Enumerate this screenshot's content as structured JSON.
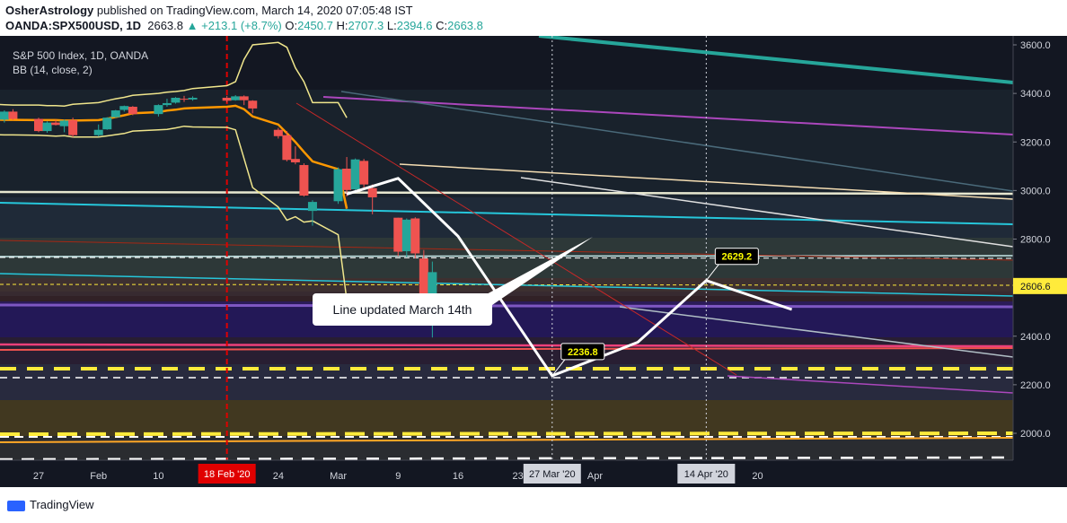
{
  "header": {
    "publisher": "OsherAstrology",
    "published_text": "published on TradingView.com, March 14, 2020 07:05:48 IST",
    "symbol": "OANDA:SPX500USD, 1D",
    "price": "2663.8",
    "change": "▲ +213.1 (+8.7%)",
    "o_label": "O:",
    "o_val": "2450.7",
    "h_label": "H:",
    "h_val": "2707.3",
    "l_label": "L:",
    "l_val": "2394.6",
    "c_label": "C:",
    "c_val": "2663.8"
  },
  "legend": {
    "title": "S&P 500 Index, 1D, OANDA",
    "indicator": "BB (14, close, 2)"
  },
  "callout": "Line updated March 14th",
  "footer": {
    "logo_text": "TradingView"
  },
  "colors": {
    "background": "#131722",
    "up_candle": "#26a69a",
    "down_candle": "#ef5350",
    "bb_band": "#f0e68c",
    "bb_basis": "#ff9800",
    "projection": "#ffffff",
    "marker_label_bg": "#000000",
    "marker_label_text": "#ffff00"
  },
  "chart_data": {
    "type": "candlestick",
    "symbol": "OANDA:SPX500USD",
    "interval": "1D",
    "y_range": [
      1900,
      3650
    ],
    "y_ticks": [
      2000,
      2200,
      2400,
      2600,
      2800,
      3000,
      3200,
      3400,
      3600
    ],
    "y_tick_labels": [
      "2000.0",
      "2200.0",
      "2400.0",
      "2600.0",
      "2800.0",
      "3000.0",
      "3200.0",
      "3400.0",
      "3600.0"
    ],
    "x_ticks": [
      {
        "label": "27",
        "date": "2020-01-27"
      },
      {
        "label": "Feb",
        "date": "2020-02-03"
      },
      {
        "label": "10",
        "date": "2020-02-10"
      },
      {
        "label": "24",
        "date": "2020-02-24"
      },
      {
        "label": "Mar",
        "date": "2020-03-02"
      },
      {
        "label": "9",
        "date": "2020-03-09"
      },
      {
        "label": "16",
        "date": "2020-03-16"
      },
      {
        "label": "23",
        "date": "2020-03-23"
      },
      {
        "label": "Apr",
        "date": "2020-04-01"
      },
      {
        "label": "20",
        "date": "2020-04-20"
      }
    ],
    "candles": [
      {
        "date": "2020-01-21",
        "o": 3320,
        "h": 3330,
        "l": 3300,
        "c": 3322
      },
      {
        "date": "2020-01-22",
        "o": 3322,
        "h": 3332,
        "l": 3290,
        "c": 3292
      },
      {
        "date": "2020-01-23",
        "o": 3292,
        "h": 3330,
        "l": 3280,
        "c": 3325
      },
      {
        "date": "2020-01-24",
        "o": 3325,
        "h": 3335,
        "l": 3290,
        "c": 3295
      },
      {
        "date": "2020-01-27",
        "o": 3295,
        "h": 3300,
        "l": 3240,
        "c": 3245
      },
      {
        "date": "2020-01-28",
        "o": 3245,
        "h": 3285,
        "l": 3238,
        "c": 3280
      },
      {
        "date": "2020-01-29",
        "o": 3280,
        "h": 3292,
        "l": 3268,
        "c": 3270
      },
      {
        "date": "2020-01-30",
        "o": 3265,
        "h": 3292,
        "l": 3240,
        "c": 3288
      },
      {
        "date": "2020-01-31",
        "o": 3290,
        "h": 3300,
        "l": 3220,
        "c": 3228
      },
      {
        "date": "2020-02-03",
        "o": 3228,
        "h": 3272,
        "l": 3222,
        "c": 3250
      },
      {
        "date": "2020-02-04",
        "o": 3252,
        "h": 3302,
        "l": 3250,
        "c": 3300
      },
      {
        "date": "2020-02-05",
        "o": 3302,
        "h": 3332,
        "l": 3300,
        "c": 3330
      },
      {
        "date": "2020-02-06",
        "o": 3332,
        "h": 3350,
        "l": 3325,
        "c": 3348
      },
      {
        "date": "2020-02-07",
        "o": 3345,
        "h": 3348,
        "l": 3310,
        "c": 3315
      },
      {
        "date": "2020-02-10",
        "o": 3315,
        "h": 3355,
        "l": 3305,
        "c": 3352
      },
      {
        "date": "2020-02-11",
        "o": 3352,
        "h": 3378,
        "l": 3345,
        "c": 3360
      },
      {
        "date": "2020-02-12",
        "o": 3362,
        "h": 3385,
        "l": 3358,
        "c": 3382
      },
      {
        "date": "2020-02-13",
        "o": 3378,
        "h": 3390,
        "l": 3365,
        "c": 3375
      },
      {
        "date": "2020-02-14",
        "o": 3375,
        "h": 3388,
        "l": 3370,
        "c": 3382
      },
      {
        "date": "2020-02-18",
        "o": 3382,
        "h": 3390,
        "l": 3362,
        "c": 3370
      },
      {
        "date": "2020-02-19",
        "o": 3372,
        "h": 3393,
        "l": 3370,
        "c": 3388
      },
      {
        "date": "2020-02-20",
        "o": 3388,
        "h": 3392,
        "l": 3352,
        "c": 3372
      },
      {
        "date": "2020-02-21",
        "o": 3370,
        "h": 3372,
        "l": 3318,
        "c": 3338
      },
      {
        "date": "2020-02-24",
        "o": 3250,
        "h": 3258,
        "l": 3214,
        "c": 3224
      },
      {
        "date": "2020-02-25",
        "o": 3228,
        "h": 3245,
        "l": 3120,
        "c": 3126
      },
      {
        "date": "2020-02-26",
        "o": 3130,
        "h": 3182,
        "l": 3108,
        "c": 3116
      },
      {
        "date": "2020-02-27",
        "o": 3105,
        "h": 3112,
        "l": 2975,
        "c": 2979
      },
      {
        "date": "2020-02-28",
        "o": 2916,
        "h": 2960,
        "l": 2855,
        "c": 2953
      },
      {
        "date": "2020-03-02",
        "o": 2956,
        "h": 3095,
        "l": 2945,
        "c": 3088
      },
      {
        "date": "2020-03-03",
        "o": 3090,
        "h": 3138,
        "l": 2975,
        "c": 3002
      },
      {
        "date": "2020-03-04",
        "o": 3005,
        "h": 3132,
        "l": 3002,
        "c": 3128
      },
      {
        "date": "2020-03-05",
        "o": 3122,
        "h": 3130,
        "l": 3005,
        "c": 3025
      },
      {
        "date": "2020-03-06",
        "o": 3010,
        "h": 3025,
        "l": 2902,
        "c": 2972
      },
      {
        "date": "2020-03-09",
        "o": 2888,
        "h": 2888,
        "l": 2730,
        "c": 2748
      },
      {
        "date": "2020-03-10",
        "o": 2750,
        "h": 2885,
        "l": 2725,
        "c": 2880
      },
      {
        "date": "2020-03-11",
        "o": 2885,
        "h": 2890,
        "l": 2720,
        "c": 2741
      },
      {
        "date": "2020-03-12",
        "o": 2720,
        "h": 2755,
        "l": 2450,
        "c": 2450
      },
      {
        "date": "2020-03-13",
        "o": 2450.7,
        "h": 2707.3,
        "l": 2394.6,
        "c": 2663.8
      }
    ],
    "bollinger": {
      "period": 14,
      "source": "close",
      "mult": 2,
      "upper": [
        3353,
        3355,
        3353,
        3352,
        3352,
        3350,
        3350,
        3348,
        3355,
        3362,
        3370,
        3378,
        3384,
        3392,
        3400,
        3405,
        3408,
        3412,
        3420,
        3432,
        3448,
        3540,
        3600,
        3610,
        3590,
        3505,
        3448,
        3362,
        3362,
        3300
      ],
      "basis": [
        3292,
        3292,
        3291,
        3291,
        3290,
        3290,
        3290,
        3288,
        3288,
        3290,
        3296,
        3303,
        3310,
        3318,
        3323,
        3329,
        3333,
        3338,
        3340,
        3345,
        3349,
        3335,
        3305,
        3272,
        3236,
        3200,
        3159,
        3120,
        3088,
        2925
      ],
      "lower": [
        3232,
        3230,
        3229,
        3229,
        3228,
        3226,
        3224,
        3226,
        3220,
        3220,
        3225,
        3230,
        3235,
        3245,
        3250,
        3252,
        3258,
        3265,
        3262,
        3260,
        3250,
        3132,
        3012,
        2932,
        2878,
        2892,
        2870,
        2875,
        2818,
        2550
      ]
    },
    "projection": [
      {
        "date": "2020-03-03",
        "y": 2985
      },
      {
        "date": "2020-03-09",
        "y": 3050
      },
      {
        "date": "2020-03-16",
        "y": 2812
      },
      {
        "date": "2020-03-27",
        "y": 2236.8
      },
      {
        "date": "2020-04-06",
        "y": 2375
      },
      {
        "date": "2020-04-14",
        "y": 2629.2
      },
      {
        "date": "2020-04-24",
        "y": 2510
      }
    ],
    "price_markers": [
      {
        "label": "2236.8",
        "date": "2020-03-27",
        "y": 2236.8
      },
      {
        "label": "2629.2",
        "date": "2020-04-14",
        "y": 2629.2
      }
    ],
    "axis_badge": {
      "label": "2606.6",
      "y": 2606.6
    },
    "date_badges": [
      {
        "label": "18 Feb '20",
        "date": "2020-02-18",
        "color": "#e00000"
      },
      {
        "label": "27 Mar '20",
        "date": "2020-03-27",
        "color": "#d1d4dc"
      },
      {
        "label": "14 Apr '20",
        "date": "2020-04-14",
        "color": "#d1d4dc"
      }
    ]
  }
}
